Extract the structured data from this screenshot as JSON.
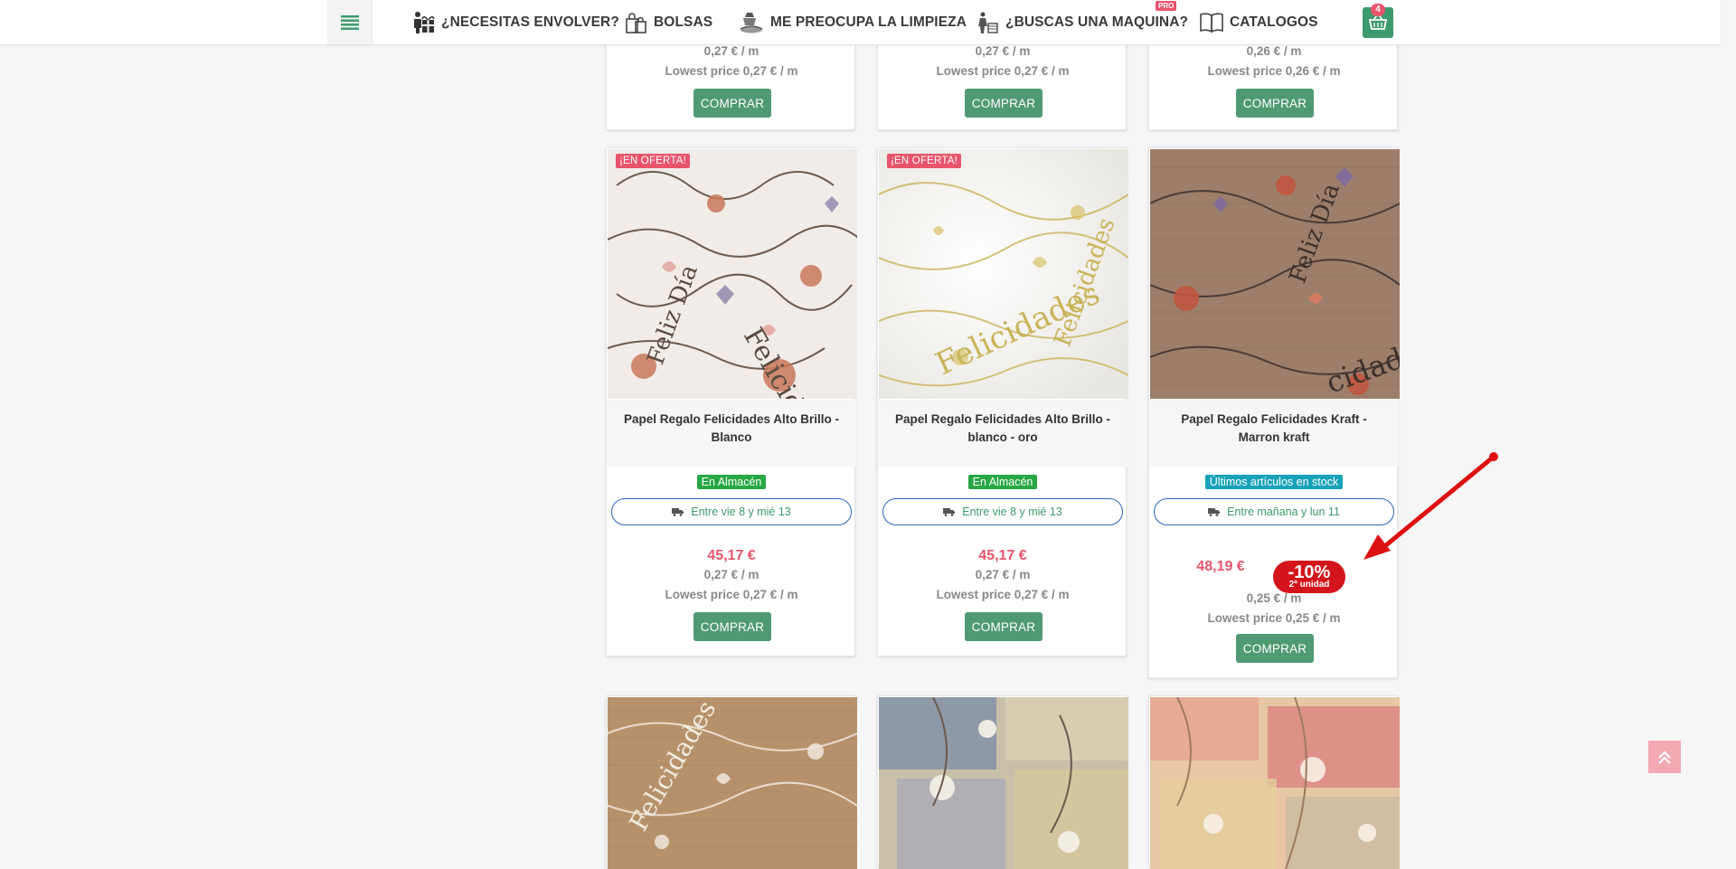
{
  "header": {
    "nav": [
      {
        "label": "¿NECESITAS ENVOLVER?",
        "icon": "gift-person-icon"
      },
      {
        "label": "BOLSAS",
        "icon": "bags-icon"
      },
      {
        "label": "ME PREOCUPA LA LIMPIEZA",
        "icon": "cleaning-icon"
      },
      {
        "label": "¿BUSCAS UNA MAQUINA?",
        "icon": "machine-icon"
      },
      {
        "label": "CATALOGOS",
        "icon": "book-icon"
      }
    ],
    "pro_badge": "PRO",
    "cart_count": "4"
  },
  "top_row": [
    {
      "unit": "0,27 € / m",
      "lowest": "Lowest price 0,27 € / m",
      "buy": "COMPRAR"
    },
    {
      "unit": "0,27 € / m",
      "lowest": "Lowest price 0,27 € / m",
      "buy": "COMPRAR"
    },
    {
      "unit": "0,26 € / m",
      "lowest": "Lowest price 0,26 € / m",
      "buy": "COMPRAR"
    }
  ],
  "products": [
    {
      "badge": "¡EN OFERTA!",
      "title": "Papel Regalo Felicidades Alto Brillo - Blanco",
      "stock": "En Almacén",
      "stock_color": "#28a745",
      "delivery": "Entre vie 8 y mié 13",
      "price": "45,17 €",
      "unit": "0,27 € / m",
      "lowest": "Lowest price 0,27 € / m",
      "buy": "COMPRAR"
    },
    {
      "badge": "¡EN OFERTA!",
      "title": "Papel Regalo Felicidades Alto Brillo - blanco - oro",
      "stock": "En Almacén",
      "stock_color": "#28a745",
      "delivery": "Entre vie 8 y mié 13",
      "price": "45,17 €",
      "unit": "0,27 € / m",
      "lowest": "Lowest price 0,27 € / m",
      "buy": "COMPRAR"
    },
    {
      "title": "Papel Regalo Felicidades Kraft - Marron kraft",
      "stock": "Últimos artículos en stock",
      "stock_color": "#17a2b8",
      "delivery": "Entre mañana y lun 11",
      "price": "48,19 €",
      "discount": "-10%",
      "discount_sub": "2ª unidad",
      "unit": "0,25 € / m",
      "lowest": "Lowest price 0,25 € / m",
      "buy": "COMPRAR"
    }
  ],
  "colors": {
    "accent_pink": "#e8546c",
    "buy_green": "#4f9a73",
    "delivery_border": "#2b65c0",
    "discount_red": "#d4141b"
  }
}
